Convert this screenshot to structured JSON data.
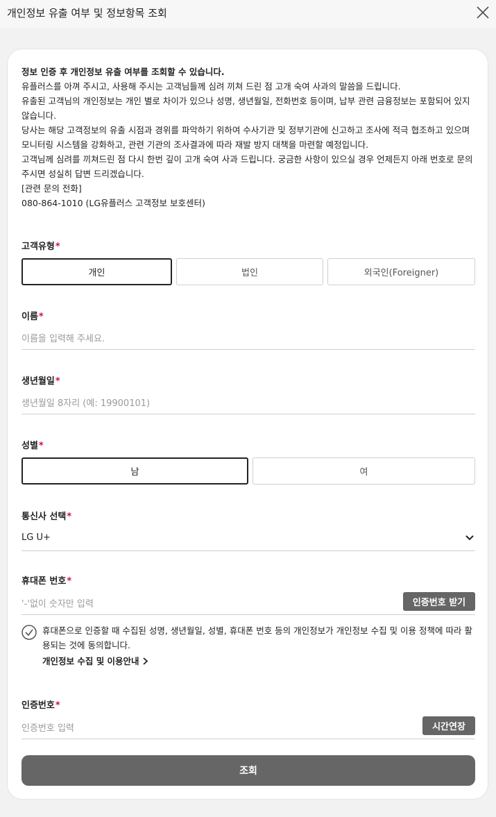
{
  "window": {
    "title": "개인정보 유출 여부 및 정보항목 조회",
    "close_icon": "close-icon"
  },
  "intro": {
    "heading": "정보 인증 후 개인정보 유출 여부를 조회할 수 있습니다.",
    "paragraphs": [
      "유플러스를 아껴 주시고, 사용해 주시는 고객님들께 심려 끼쳐 드린 점 고개 숙여 사과의 말씀을 드립니다.",
      "유출된 고객님의 개인정보는 개인 별로 차이가 있으나 성명, 생년월일, 전화번호 등이며, 납부 관련 금융정보는 포함되어 있지 않습니다.",
      "당사는 해당 고객정보의 유출 시점과 경위를 파악하기 위하여 수사기관 및 정부기관에 신고하고 조사에 적극 협조하고 있으며 모니터링 시스템을 강화하고, 관련 기관의 조사결과에 따라 재발 방지 대책을 마련할 예정입니다.",
      "고객님께 심려를 끼쳐드린 점 다시 한번 깊이 고개 숙여 사과 드립니다. 궁금한 사항이 있으실 경우 언제든지 아래 번호로 문의주시면 성실히 답변 드리겠습니다.",
      "[관련 문의 전화]",
      "080-864-1010 (LG유플러스 고객정보 보호센터)"
    ]
  },
  "form": {
    "required_mark": "*",
    "customer_type": {
      "label": "고객유형",
      "options": [
        "개인",
        "법인",
        "외국인(Foreigner)"
      ],
      "selected": "개인"
    },
    "name": {
      "label": "이름",
      "placeholder": "이름을 입력해 주세요."
    },
    "birth": {
      "label": "생년월일",
      "placeholder": "생년월일 8자리 (예: 19900101)"
    },
    "gender": {
      "label": "성별",
      "options": [
        "남",
        "여"
      ],
      "selected": "남"
    },
    "carrier": {
      "label": "통신사 선택",
      "value": "LG U+"
    },
    "phone": {
      "label": "휴대폰 번호",
      "placeholder": "'-'없이 숫자만 입력",
      "button": "인증번호 받기"
    },
    "consent": {
      "text": "휴대폰으로 인증할 때 수집된 성명, 생년월일, 성별, 휴대폰 번호 등의 개인정보가 개인정보 수집 및 이용 정책에 따라 활용되는 것에 동의합니다.",
      "link": "개인정보 수집 및 이용안내"
    },
    "auth_code": {
      "label": "인증번호",
      "placeholder": "인증번호 입력",
      "button": "시간연장"
    },
    "submit": "조회"
  }
}
